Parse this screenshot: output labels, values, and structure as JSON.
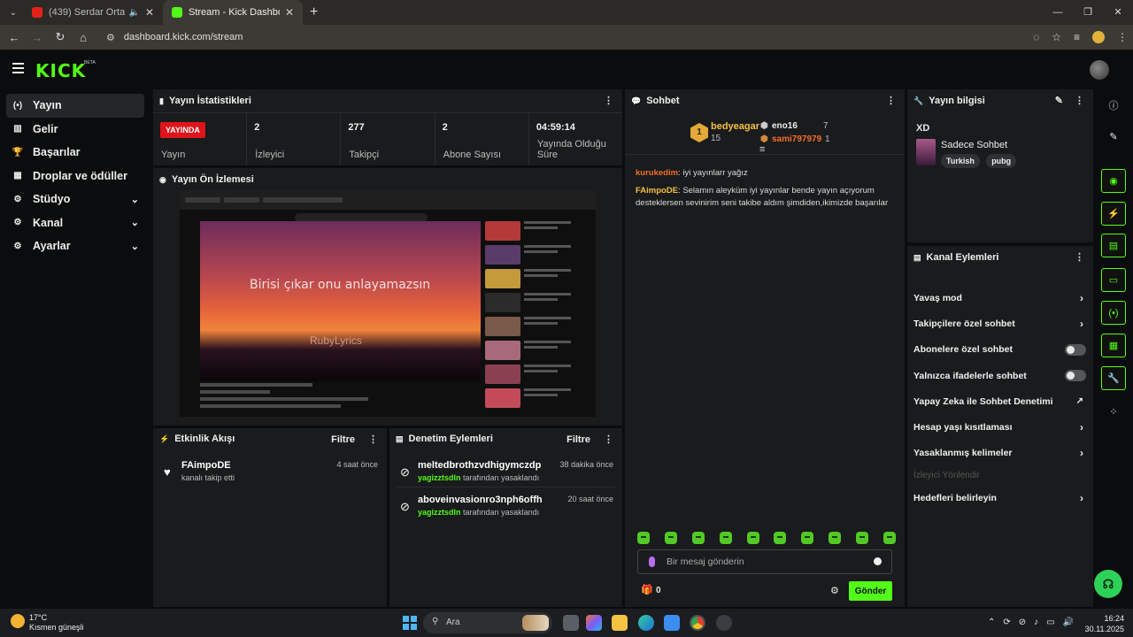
{
  "browser": {
    "tabs": [
      {
        "title": "(439) Serdar Ortaç - Dansöz",
        "active": false
      },
      {
        "title": "Stream - Kick Dashboard",
        "active": true
      }
    ],
    "url": "dashboard.kick.com/stream"
  },
  "kick": {
    "logo": "KICK",
    "beta": "BETA"
  },
  "sidebar": {
    "items": [
      {
        "label": "Yayın",
        "icon": "broadcast-icon",
        "glyph": "(•)"
      },
      {
        "label": "Gelir",
        "icon": "revenue-icon",
        "glyph": "▥"
      },
      {
        "label": "Başarılar",
        "icon": "trophy-icon",
        "glyph": "🏆"
      },
      {
        "label": "Droplar ve ödüller",
        "icon": "drops-icon",
        "glyph": "▦"
      },
      {
        "label": "Stüdyo",
        "icon": "studio-icon",
        "glyph": "⚙"
      },
      {
        "label": "Kanal",
        "icon": "channel-icon",
        "glyph": "⚙"
      },
      {
        "label": "Ayarlar",
        "icon": "settings-icon",
        "glyph": "⚙"
      }
    ]
  },
  "stats": {
    "title": "Yayın İstatistikleri",
    "live_badge": "YAYINDA",
    "live_label": "Yayın",
    "items": [
      {
        "value": "2",
        "label": "İzleyici"
      },
      {
        "value": "277",
        "label": "Takipçi"
      },
      {
        "value": "2",
        "label": "Abone Sayısı"
      },
      {
        "value": "04:59:14",
        "label": "Yayında Olduğu Süre"
      }
    ]
  },
  "preview": {
    "title": "Yayın Ön İzlemesi",
    "caption": "Birisi çıkar onu anlayamazsın",
    "watermark": "RubyLyrics"
  },
  "activity": {
    "title": "Etkinlik Akışı",
    "filter": "Filtre",
    "items": [
      {
        "name": "FAimpoDE",
        "sub": "kanalı takip etti",
        "time": "4 saat önce"
      }
    ]
  },
  "moderation": {
    "title": "Denetim Eylemleri",
    "filter": "Filtre",
    "by_suffix": "tarafından yasaklandı",
    "items": [
      {
        "name": "meltedbrothzvdhigymczdp",
        "by": "yagizztsdln",
        "time": "38 dakika önce"
      },
      {
        "name": "aboveinvasionro3nph6offh",
        "by": "yagizztsdln",
        "time": "20 saat önce"
      }
    ]
  },
  "chat": {
    "title": "Sohbet",
    "leaderboard": {
      "first": {
        "rank": "1",
        "name": "bedyeagar",
        "count": "15"
      },
      "second": {
        "name": "eno16",
        "count": "7"
      },
      "third": {
        "name": "sami797979",
        "count": "1"
      }
    },
    "messages": [
      {
        "user": "kurukedim",
        "text": "iyi yayınlarr yağız"
      },
      {
        "user": "FAimpoDE",
        "text": "Selamın aleyküm iyi yayınlar bende yayın açıyorum desteklersen sevinirim seni takibe aldım şimdiden,ikimizde başarılar"
      }
    ],
    "placeholder": "Bir mesaj gönderin",
    "counter": "0",
    "send": "Gönder"
  },
  "stream_info": {
    "title": "Yayın bilgisi",
    "stream_title": "XD",
    "category": "Sadece Sohbet",
    "tags": [
      "Turkish",
      "pubg"
    ]
  },
  "channel_actions": {
    "title": "Kanal Eylemleri",
    "items": [
      {
        "label": "Yavaş mod",
        "control": "chevron"
      },
      {
        "label": "Takipçilere özel sohbet",
        "control": "chevron"
      },
      {
        "label": "Abonelere özel sohbet",
        "control": "toggle"
      },
      {
        "label": "Yalnızca ifadelerle sohbet",
        "control": "toggle"
      },
      {
        "label": "Yapay Zeka ile Sohbet Denetimi",
        "control": "external"
      },
      {
        "label": "Hesap yaşı kısıtlaması",
        "control": "chevron"
      },
      {
        "label": "Yasaklanmış kelimeler",
        "control": "chevron"
      },
      {
        "label": "İzleyici Yönlendir",
        "control": "disabled"
      },
      {
        "label": "Hedefleri belirleyin",
        "control": "chevron"
      }
    ]
  },
  "taskbar": {
    "temp": "17°C",
    "weather": "Kısmen güneşli",
    "search": "Ara",
    "time": "16:24",
    "date": "30.11.2025"
  },
  "colors": {
    "accent": "#53fc18",
    "live": "#e0141b",
    "panel": "#191b1c"
  }
}
